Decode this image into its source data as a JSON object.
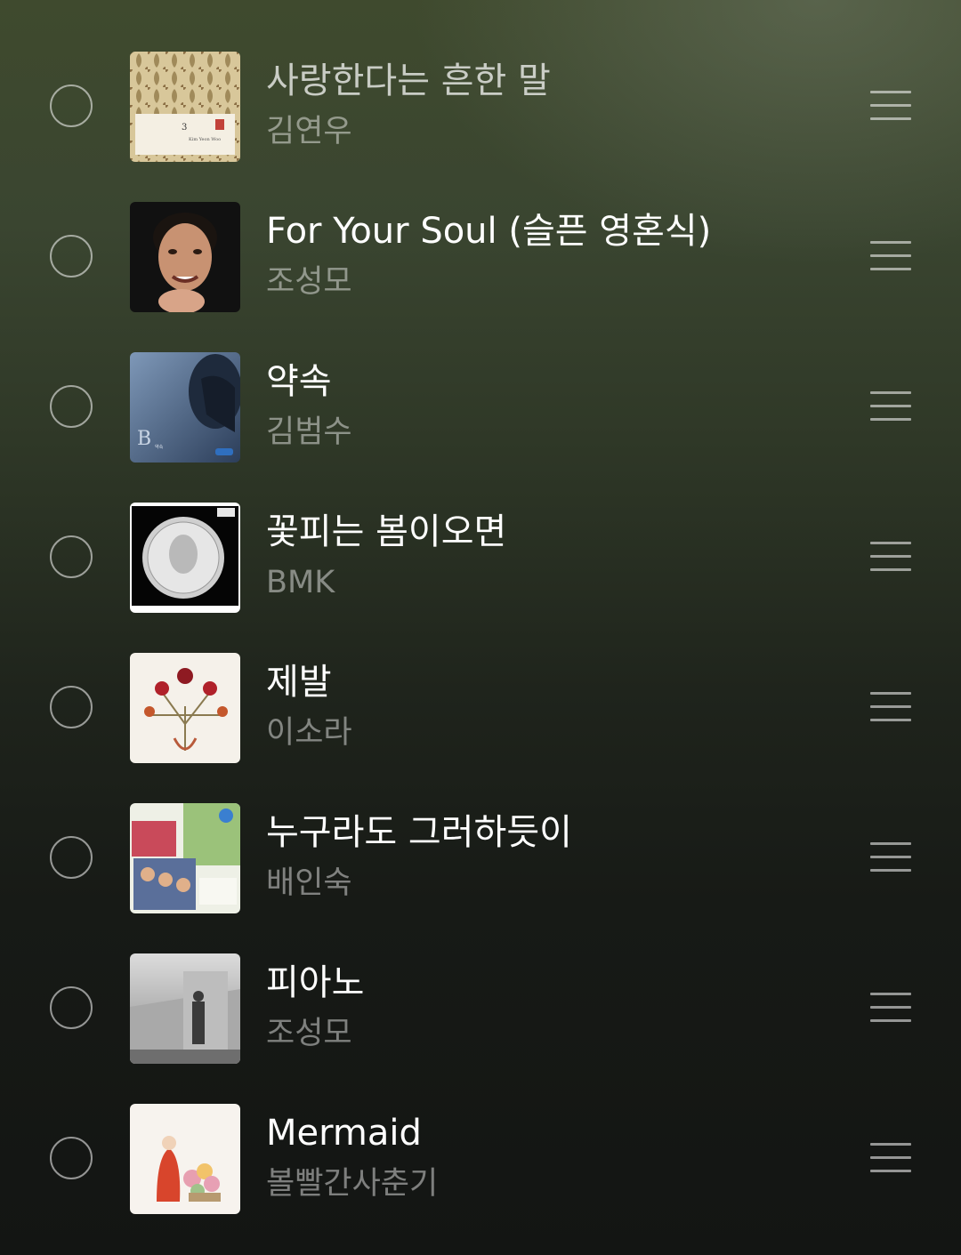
{
  "tracks": [
    {
      "title": "사랑한다는 흔한 말",
      "artist": "김연우",
      "title_dim": true,
      "cover_icon": "album-cover-damask-pattern"
    },
    {
      "title": "For Your Soul (슬픈 영혼식)",
      "artist": "조성모",
      "cover_icon": "album-cover-portrait"
    },
    {
      "title": "약속",
      "artist": "김범수",
      "cover_icon": "album-cover-blue-portrait"
    },
    {
      "title": "꽃피는 봄이오면",
      "artist": "BMK",
      "cover_icon": "album-cover-coin"
    },
    {
      "title": "제발",
      "artist": "이소라",
      "cover_icon": "album-cover-flowers"
    },
    {
      "title": "누구라도 그러하듯이",
      "artist": "배인숙",
      "cover_icon": "album-cover-collage"
    },
    {
      "title": "피아노",
      "artist": "조성모",
      "cover_icon": "album-cover-street-photo"
    },
    {
      "title": "Mermaid",
      "artist": "볼빨간사춘기",
      "cover_icon": "album-cover-illustration"
    }
  ],
  "colors": {
    "title": "#ffffff",
    "artist": "#8a8f86",
    "control": "#9a9d96"
  }
}
